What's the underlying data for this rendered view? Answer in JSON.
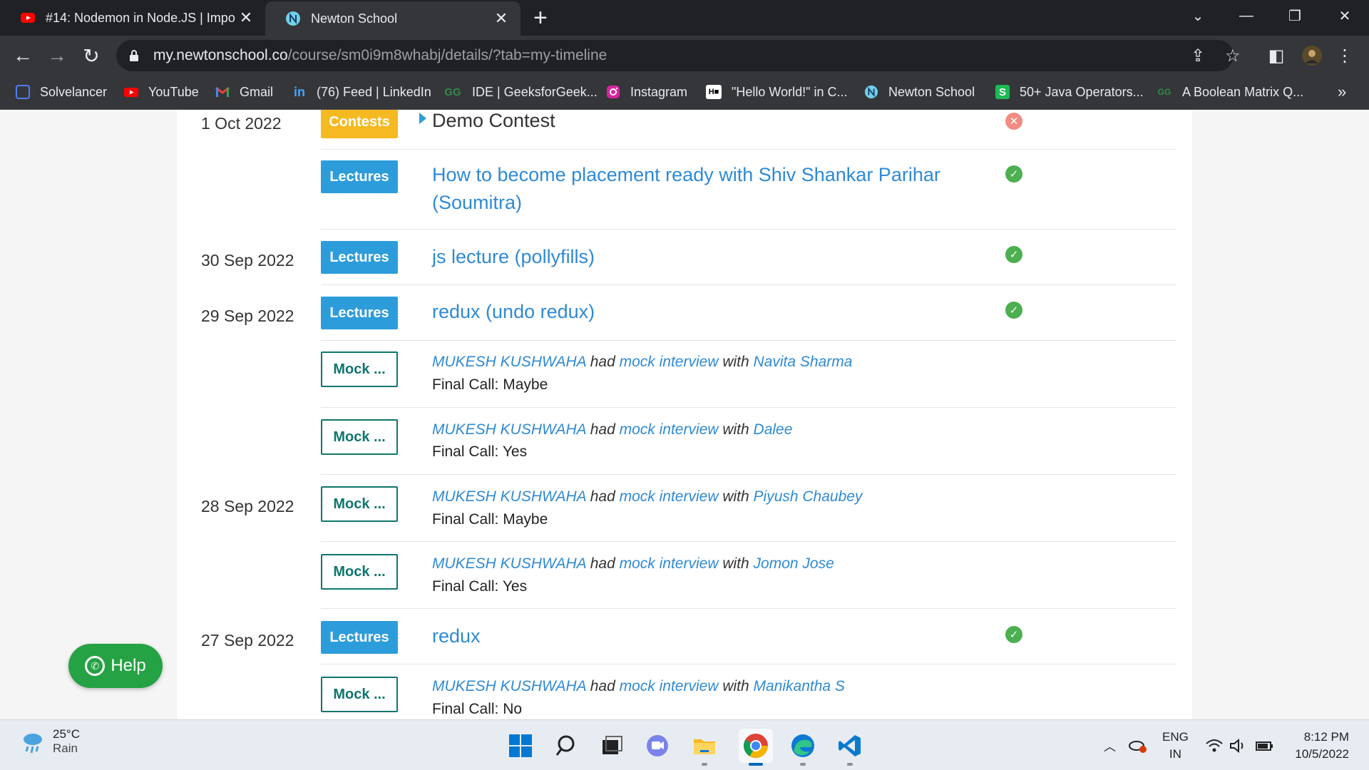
{
  "browser": {
    "tabs": [
      {
        "title": "#14: Nodemon in Node.JS | Impo",
        "favicon": "youtube-icon",
        "active": false
      },
      {
        "title": "Newton School",
        "favicon": "newton-school-icon",
        "active": true
      }
    ],
    "address": {
      "host": "my.newtonschool.co",
      "path": "/course/sm0i9m8whabj/details/?tab=my-timeline"
    },
    "bookmarks": [
      {
        "label": "Solvelancer",
        "icon": "solvelancer-icon"
      },
      {
        "label": "YouTube",
        "icon": "youtube-icon"
      },
      {
        "label": "Gmail",
        "icon": "gmail-icon"
      },
      {
        "label": "(76) Feed | LinkedIn",
        "icon": "linkedin-icon"
      },
      {
        "label": "IDE | GeeksforGeek...",
        "icon": "geeksforgeeks-icon"
      },
      {
        "label": "Instagram",
        "icon": "instagram-icon"
      },
      {
        "label": "\"Hello World!\" in C...",
        "icon": "hackerrank-icon"
      },
      {
        "label": "Newton School",
        "icon": "newton-school-icon"
      },
      {
        "label": "50+ Java Operators...",
        "icon": "s-icon"
      },
      {
        "label": "A Boolean Matrix Q...",
        "icon": "geeksforgeeks-icon"
      }
    ],
    "more_bookmarks": "»"
  },
  "timeline": {
    "dates": [
      "1 Oct 2022",
      "30 Sep 2022",
      "29 Sep 2022",
      "28 Sep 2022",
      "27 Sep 2022"
    ],
    "badges": {
      "contests": "Contests",
      "lectures": "Lectures",
      "mock": "Mock ..."
    },
    "contest": {
      "title": "Demo Contest",
      "status": "failed"
    },
    "lectures": [
      {
        "title": "How to become placement ready with Shiv Shankar Parihar",
        "title2": "(Soumitra)",
        "status": "completed"
      },
      {
        "title": "js lecture (pollyfills)",
        "status": "completed"
      },
      {
        "title": "redux (undo redux)",
        "status": "completed"
      },
      {
        "title": "redux",
        "status": "completed"
      }
    ],
    "mock_text": {
      "had": "had",
      "with": "with",
      "event": "mock interview",
      "final_prefix": "Final Call:"
    },
    "mocks": [
      {
        "student": "MUKESH KUSHWAHA",
        "interviewer": "Navita Sharma",
        "final_call": "Maybe"
      },
      {
        "student": "MUKESH KUSHWAHA",
        "interviewer": "Dalee",
        "final_call": "Yes"
      },
      {
        "student": "MUKESH KUSHWAHA",
        "interviewer": "Piyush Chaubey",
        "final_call": "Maybe"
      },
      {
        "student": "MUKESH KUSHWAHA",
        "interviewer": "Jomon Jose",
        "final_call": "Yes"
      },
      {
        "student": "MUKESH KUSHWAHA",
        "interviewer": "Manikantha S",
        "final_call": "No"
      }
    ]
  },
  "help_button": {
    "label": "Help"
  },
  "taskbar": {
    "weather": {
      "temp": "25°C",
      "condition": "Rain"
    },
    "language": {
      "line1": "ENG",
      "line2": "IN"
    },
    "clock": {
      "time": "8:12 PM",
      "date": "10/5/2022"
    }
  },
  "colors": {
    "lectures": "#2d9cdb",
    "contests": "#f5b921",
    "mock": "#0f766e",
    "link": "#2f8ad4",
    "completed": "#4caf50",
    "failed": "#f28b82",
    "help": "#25a244"
  }
}
